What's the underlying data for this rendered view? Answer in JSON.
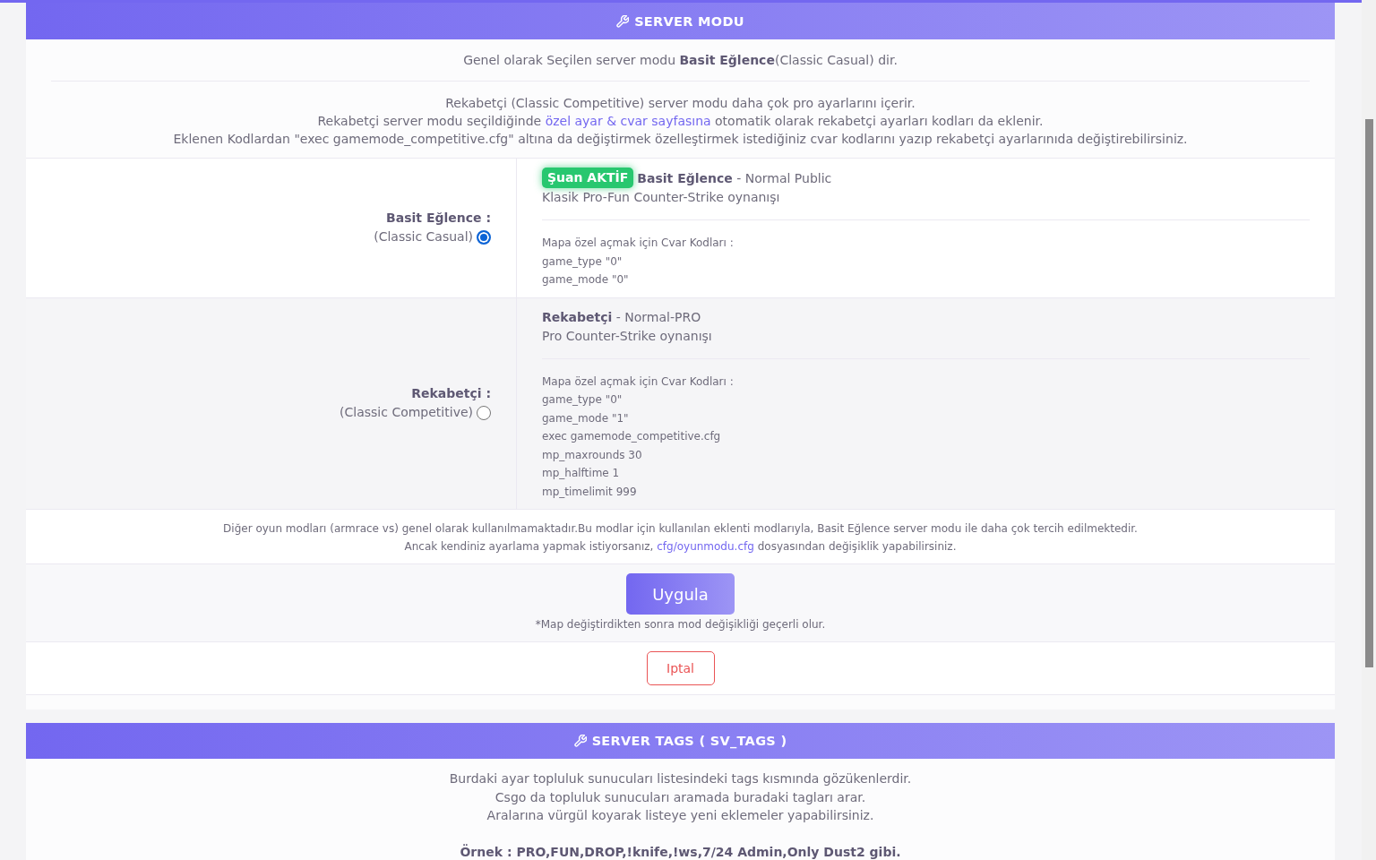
{
  "server_mode": {
    "title": "SERVER MODU",
    "summary": "Genel olarak Seçilen server modu **Basit Eğlence**(Classic Casual) dir.",
    "intro": [
      {
        "text": "Rekabetçi (Classic Competitive) server modu daha çok pro ayarlarını içerir."
      },
      {
        "text": "Rekabetçi server modu seçildiğinde ",
        "link": "özel ayar & cvar sayfasına",
        "text_after": " otomatik olarak rekabetçi ayarları kodları da eklenir."
      },
      {
        "text": "Eklenen Kodlardan \"exec gamemode_competitive.cfg\" altına da değiştirmek özelleştirmek istediğiniz cvar kodlarını yazıp rekabetçi ayarlarınıda değiştirebilirsiniz."
      }
    ],
    "modes": [
      {
        "label": "Basit Eğlence :",
        "sublabel": "(Classic Casual)",
        "selected": true,
        "badge": "Şuan AKTİF",
        "headline": "**Basit Eğlence** - Normal Public",
        "description": "Klasik Pro-Fun Counter-Strike oynanışı",
        "cvar_heading": "Mapa özel açmak için Cvar Kodları :",
        "cvars": [
          "game_type \"0\"",
          "game_mode \"0\""
        ]
      },
      {
        "label": "Rekabetçi :",
        "sublabel": "(Classic Competitive)",
        "selected": false,
        "headline": "**Rekabetçi** - Normal-PRO",
        "description": "Pro Counter-Strike oynanışı",
        "cvar_heading": "Mapa özel açmak için Cvar Kodları :",
        "cvars": [
          "game_type \"0\"",
          "game_mode \"1\"",
          "exec gamemode_competitive.cfg",
          "mp_maxrounds 30",
          "mp_halftime 1",
          "mp_timelimit 999"
        ]
      }
    ],
    "other_modes_note": [
      {
        "text": "Diğer oyun modları (armrace vs) genel olarak kullanılmamaktadır.Bu modlar için kullanılan eklenti modlarıyla, Basit Eğlence server modu ile daha çok tercih edilmektedir."
      },
      {
        "text": "Ancak kendiniz ayarlama yapmak istiyorsanız, ",
        "link": "cfg/oyunmodu.cfg",
        "text_after": " dosyasından değişiklik yapabilirsiniz."
      }
    ],
    "apply_button": "Uygula",
    "apply_hint": "*Map değiştirdikten sonra mod değişikliği geçerli olur.",
    "cancel_button": "Iptal"
  },
  "server_tags": {
    "title": "SERVER TAGS ( SV_TAGS )",
    "info_lines": [
      "Burdaki ayar topluluk sunucuları listesindeki tags kısmında gözükenlerdir.",
      "Csgo da topluluk sunucuları aramada buradaki tagları arar.",
      "Aralarına vürgül koyarak listeye yeni eklemeler yapabilirsiniz."
    ],
    "example": "Örnek : PRO,FUN,DROP,!knife,!ws,7/24 Admin,Only Dust2 gibi."
  }
}
